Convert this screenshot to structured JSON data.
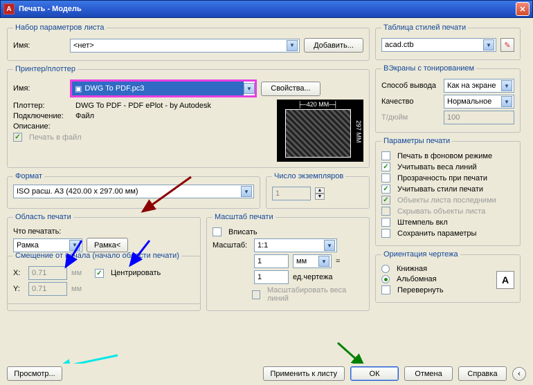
{
  "title": "Печать - Модель",
  "pageSet": {
    "legend": "Набор параметров листа",
    "nameLabel": "Имя:",
    "nameValue": "<нет>",
    "addBtn": "Добавить..."
  },
  "printer": {
    "legend": "Принтер/плоттер",
    "nameLabel": "Имя:",
    "nameValue": "DWG To PDF.pc3",
    "propsBtn": "Свойства...",
    "plotterLabel": "Плоттер:",
    "plotterValue": "DWG To PDF - PDF ePlot - by Autodesk",
    "portLabel": "Подключение:",
    "portValue": "Файл",
    "descLabel": "Описание:",
    "toFile": "Печать в файл",
    "paperW": "420 MM",
    "paperH": "297 MM"
  },
  "format": {
    "legend": "Формат",
    "value": "ISO расш. A3 (420.00 x 297.00 мм)"
  },
  "copies": {
    "legend": "Число экземпляров",
    "value": "1"
  },
  "area": {
    "legend": "Область печати",
    "whatLabel": "Что печатать:",
    "whatValue": "Рамка",
    "windowBtn": "Рамка<"
  },
  "scale": {
    "legend": "Масштаб печати",
    "fit": "Вписать",
    "scaleLabel": "Масштаб:",
    "scaleValue": "1:1",
    "numA": "1",
    "unitValue": "мм",
    "eq": "=",
    "numB": "1",
    "unitB": "ед.чертежа",
    "scaleLW": "Масштабировать веса линий"
  },
  "offset": {
    "legend": "Смещение от начала (начало области печати)",
    "xLabel": "X:",
    "xValue": "0.71",
    "xUnit": "мм",
    "yLabel": "Y:",
    "yValue": "0.71",
    "yUnit": "мм",
    "center": "Центрировать"
  },
  "styleTable": {
    "legend": "Таблица стилей печати",
    "value": "acad.ctb"
  },
  "shade": {
    "legend": "ВЭкраны с тонированием",
    "modeLabel": "Способ вывода",
    "modeValue": "Как на экране",
    "qLabel": "Качество",
    "qValue": "Нормальное",
    "dpiLabel": "Т/дюйм",
    "dpiValue": "100"
  },
  "options": {
    "legend": "Параметры печати",
    "bg": "Печать в фоновом режиме",
    "lw": "Учитывать веса линий",
    "trans": "Прозрачность при печати",
    "styles": "Учитывать стили печати",
    "paperLast": "Объекты листа последними",
    "hide": "Скрывать объекты листа",
    "stamp": "Штемпель вкл",
    "save": "Сохранить параметры"
  },
  "orient": {
    "legend": "Ориентация чертежа",
    "portrait": "Книжная",
    "landscape": "Альбомная",
    "upside": "Перевернуть"
  },
  "bottom": {
    "preview": "Просмотр...",
    "apply": "Применить к листу",
    "ok": "ОК",
    "cancel": "Отмена",
    "help": "Справка"
  }
}
